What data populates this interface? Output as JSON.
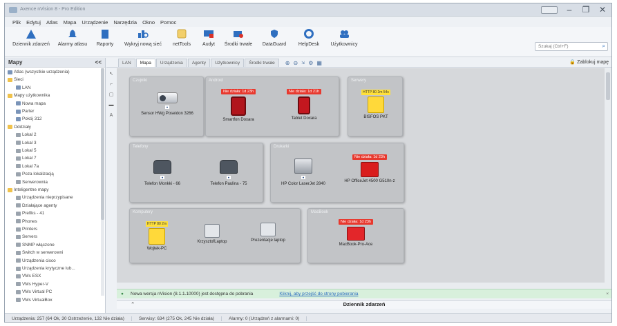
{
  "window": {
    "title": "Axence nVision 8 - Pro Edition"
  },
  "menu": [
    "Plik",
    "Edytuj",
    "Atlas",
    "Mapa",
    "Urządzenie",
    "Narzędzia",
    "Okno",
    "Pomoc"
  ],
  "toolbar": {
    "items": [
      {
        "label": "Dziennik zdarzeń",
        "icon": "warning-icon"
      },
      {
        "label": "Alarmy atlasu",
        "icon": "bell-icon"
      },
      {
        "label": "Raporty",
        "icon": "report-icon"
      },
      {
        "label": "Wykryj nową sieć",
        "icon": "network-scan-icon"
      },
      {
        "label": "netTools",
        "icon": "nettools-icon"
      },
      {
        "label": "Audyt",
        "icon": "audit-icon"
      },
      {
        "label": "Środki trwałe",
        "icon": "assets-icon"
      },
      {
        "label": "DataGuard",
        "icon": "shield-icon"
      },
      {
        "label": "HelpDesk",
        "icon": "helpdesk-icon"
      },
      {
        "label": "Użytkownicy",
        "icon": "users-icon"
      }
    ],
    "search_placeholder": "Szukaj (Ctrl+F)"
  },
  "sidebar": {
    "title": "Mapy",
    "collapse": "<<",
    "items": [
      {
        "label": "Atlas (wszystkie urządzenia)",
        "icon": "m",
        "level": 0
      },
      {
        "label": "Sieci",
        "icon": "f",
        "level": 0
      },
      {
        "label": "LAN",
        "icon": "m",
        "level": 1
      },
      {
        "label": "Mapy użytkownika",
        "icon": "f",
        "level": 0
      },
      {
        "label": "Nowa mapa",
        "icon": "m",
        "level": 1
      },
      {
        "label": "Parter",
        "icon": "m",
        "level": 1
      },
      {
        "label": "Pokój 312",
        "icon": "m",
        "level": 1
      },
      {
        "label": "Oddziały",
        "icon": "f",
        "level": 0
      },
      {
        "label": "Lokal 2",
        "icon": "s",
        "level": 1
      },
      {
        "label": "Lokal 3",
        "icon": "s",
        "level": 1
      },
      {
        "label": "Lokal 5",
        "icon": "s",
        "level": 1
      },
      {
        "label": "Lokal 7",
        "icon": "s",
        "level": 1
      },
      {
        "label": "Lokal 7a",
        "icon": "s",
        "level": 1
      },
      {
        "label": "Poza lokalizacją",
        "icon": "s",
        "level": 1
      },
      {
        "label": "Serwerownia",
        "icon": "s",
        "level": 1
      },
      {
        "label": "Inteligentne mapy",
        "icon": "f",
        "level": 0
      },
      {
        "label": "Urządzenia nieprzypisane",
        "icon": "s",
        "level": 1
      },
      {
        "label": "Działające agenty",
        "icon": "s",
        "level": 1
      },
      {
        "label": "Prefiks - 41",
        "icon": "s",
        "level": 1
      },
      {
        "label": "Phones",
        "icon": "s",
        "level": 1
      },
      {
        "label": "Printers",
        "icon": "s",
        "level": 1
      },
      {
        "label": "Servers",
        "icon": "s",
        "level": 1
      },
      {
        "label": "SNMP włączone",
        "icon": "s",
        "level": 1
      },
      {
        "label": "Switch w serwerowni",
        "icon": "s",
        "level": 1
      },
      {
        "label": "Urządzenia cisco",
        "icon": "s",
        "level": 1
      },
      {
        "label": "Urządzenia krytyczne lub...",
        "icon": "s",
        "level": 1
      },
      {
        "label": "VMs ESX",
        "icon": "s",
        "level": 1
      },
      {
        "label": "VMs Hyper-V",
        "icon": "s",
        "level": 1
      },
      {
        "label": "VMs Virtual PC",
        "icon": "s",
        "level": 1
      },
      {
        "label": "VMs VirtualBox",
        "icon": "s",
        "level": 1
      }
    ]
  },
  "tabs": {
    "lan": "LAN",
    "items": [
      "Mapa",
      "Urządzenia",
      "Agenty",
      "Użytkownicy",
      "Środki trwałe"
    ],
    "lock": "Zablokuj mapę"
  },
  "groups": [
    {
      "title": "Czujniki",
      "devices": [
        {
          "label": "Sensor HWg Poseidon 3266",
          "badge": "",
          "icon": "projector"
        }
      ]
    },
    {
      "title": "Android",
      "devices": [
        {
          "label": "Smartfon Doxara",
          "badge": "Nie działa: 1d 23h",
          "icon": "phone-red"
        },
        {
          "label": "Tablet Doxara",
          "badge": "Nie działa: 1d 21h",
          "icon": "tablet-red"
        }
      ]
    },
    {
      "title": "Serwery",
      "devices": [
        {
          "label": "BISFOS PKT",
          "badge": "HTTP 80 2m 54s",
          "icon": "yellow"
        }
      ]
    },
    {
      "title": "Telefony",
      "devices": [
        {
          "label": "Telefon Monkki - 66",
          "badge": "",
          "icon": "voip"
        },
        {
          "label": "Telefon Paulina - 75",
          "badge": "",
          "icon": "voip"
        }
      ]
    },
    {
      "title": "Drukarki",
      "devices": [
        {
          "label": "HP Color LaserJet 2840",
          "badge": "",
          "icon": "laser"
        },
        {
          "label": "HP OfficeJet 4500 G510n-z",
          "badge": "Nie działa: 1d 23h",
          "icon": "printer-red"
        }
      ]
    },
    {
      "title": "Komputery",
      "devices": [
        {
          "label": "Wojtek-PC",
          "badge": "HTTP 80 2m",
          "icon": "yellow"
        },
        {
          "label": "KrzysztofLaptop",
          "badge": "",
          "icon": "pc"
        },
        {
          "label": "Prezentacje laptop",
          "badge": "",
          "icon": "pc"
        }
      ]
    },
    {
      "title": "MacBook",
      "devices": [
        {
          "label": "MacBook-Pro-Ace",
          "badge": "Nie działa: 1d 23h",
          "icon": "laptop-red"
        }
      ]
    }
  ],
  "notice": {
    "text": "Nowa wersja nVision (8.1.1.10000) jest dostępna do pobrania",
    "link": "Kliknij, aby przejść do strony pobierania"
  },
  "eventbar": {
    "label": "Dziennik zdarzeń",
    "arrow": "⌃"
  },
  "status": {
    "devices": "Urządzenia: 257 (64 Ok, 30 Ostrzeżenie, 132 Nie działa)",
    "services": "Serwisy: 634 (275 Ok, 245 Nie działa)",
    "alarms": "Alarmy: 0 (Urządzeń z alarmami: 0)"
  }
}
